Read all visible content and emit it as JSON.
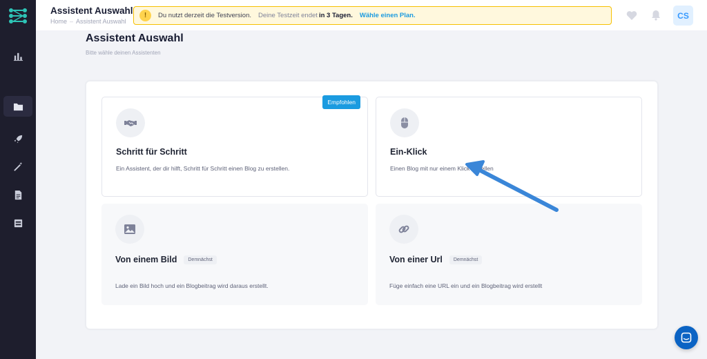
{
  "header": {
    "title": "Assistent Auswahl",
    "breadcrumbs": [
      "Home",
      "Assistent Auswahl"
    ],
    "trial": {
      "lead": "Du nutzt derzeit die Testversion.",
      "ends_prefix": "Deine Testzeit endet",
      "ends_value": "in 3 Tagen.",
      "plan_link": "Wähle einen Plan."
    },
    "user_initials": "CS"
  },
  "page": {
    "title": "Assistent Auswahl",
    "subtitle": "Bitte wähle deinen Assistenten"
  },
  "options": [
    {
      "title": "Schritt für Schritt",
      "description": "Ein Assistent, der dir hilft, Schritt für Schritt einen Blog zu erstellen.",
      "badge": "Empfohlen",
      "icon": "handshake-icon"
    },
    {
      "title": "Ein-Klick",
      "description": "Einen Blog mit nur einem Klick erstellen",
      "icon": "mouse-icon"
    },
    {
      "title": "Von einem Bild",
      "description": "Lade ein Bild hoch und ein Blogbeitrag wird daraus erstellt.",
      "badge": "Demnächst",
      "icon": "image-icon"
    },
    {
      "title": "Von einer Url",
      "description": "Füge einfach eine URL ein und ein Blogbeitrag wird erstellt",
      "badge": "Demnächst",
      "icon": "link-icon"
    }
  ],
  "colors": {
    "sidebar": "#1e1e2d",
    "accent": "#1b9be0",
    "annotation_arrow": "#3a86d8"
  }
}
